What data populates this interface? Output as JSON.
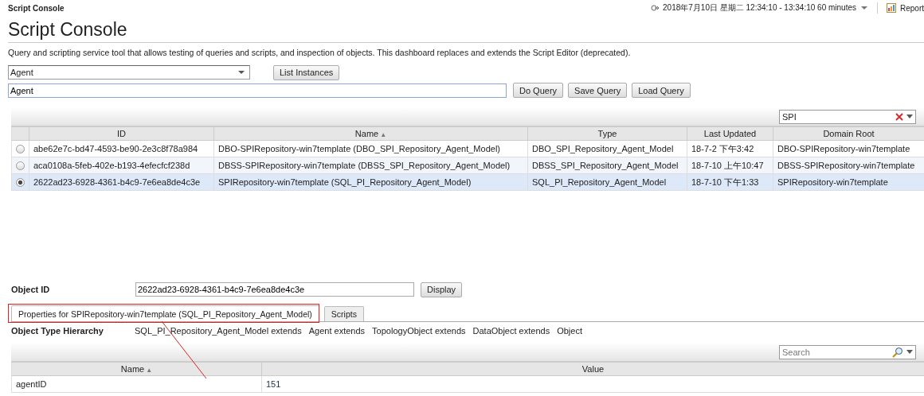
{
  "top_bar": {
    "breadcrumb": "Script Console",
    "time_range": "2018年7月10日 星期二 12:34:10 - 13:34:10 60 minutes",
    "report": "Report"
  },
  "title": "Script Console",
  "description": "Query and scripting service tool that allows testing of queries and scripts, and inspection of objects. This dashboard replaces and extends the Script Editor (deprecated).",
  "type_select": {
    "value": "Agent"
  },
  "list_button": "List Instances",
  "query_input": {
    "value": "Agent"
  },
  "query_buttons": [
    "Do Query",
    "Save Query",
    "Load Query"
  ],
  "table_filter": {
    "value": "SPI"
  },
  "table": {
    "columns": [
      {
        "label": "ID"
      },
      {
        "label": "Name",
        "sort_mark": "▲"
      },
      {
        "label": "Type"
      },
      {
        "label": "Last Updated"
      },
      {
        "label": "Domain Root"
      }
    ],
    "rows": [
      {
        "selected": false,
        "cells": [
          "abe62e7c-bd47-4593-be90-2e3c8f78a984",
          "DBO-SPIRepository-win7template (DBO_SPI_Repository_Agent_Model)",
          "DBO_SPI_Repository_Agent_Model",
          "18-7-2 下午3:42",
          "DBO-SPIRepository-win7template"
        ]
      },
      {
        "selected": false,
        "cells": [
          "aca0108a-5feb-402e-b193-4efecfcf238d",
          "DBSS-SPIRepository-win7template (DBSS_SPI_Repository_Agent_Model)",
          "DBSS_SPI_Repository_Agent_Model",
          "18-7-10 上午10:47",
          "DBSS-SPIRepository-win7template"
        ]
      },
      {
        "selected": true,
        "cells": [
          "2622ad23-6928-4361-b4c9-7e6ea8de4c3e",
          "SPIRepository-win7template (SQL_PI_Repository_Agent_Model)",
          "SQL_PI_Repository_Agent_Model",
          "18-7-10 下午1:33",
          "SPIRepository-win7template"
        ]
      }
    ]
  },
  "object_id": {
    "label": "Object ID",
    "value": "2622ad23-6928-4361-b4c9-7e6ea8de4c3e",
    "button": "Display"
  },
  "tabs": [
    {
      "label": "Properties for SPIRepository-win7template (SQL_PI_Repository_Agent_Model)",
      "selected": true
    },
    {
      "label": "Scripts",
      "selected": false
    }
  ],
  "hierarchy": {
    "label": "Object Type Hierarchy",
    "items": [
      "SQL_PI_Repository_Agent_Model extends",
      "Agent extends",
      "TopologyObject extends",
      "DataObject extends",
      "Object"
    ]
  },
  "properties_search": {
    "placeholder": "Search"
  },
  "properties": {
    "columns": [
      {
        "label": "Name",
        "sort_mark": "▲"
      },
      {
        "label": "Value"
      }
    ],
    "rows": [
      {
        "cells": [
          "agentID",
          "151"
        ]
      }
    ]
  }
}
